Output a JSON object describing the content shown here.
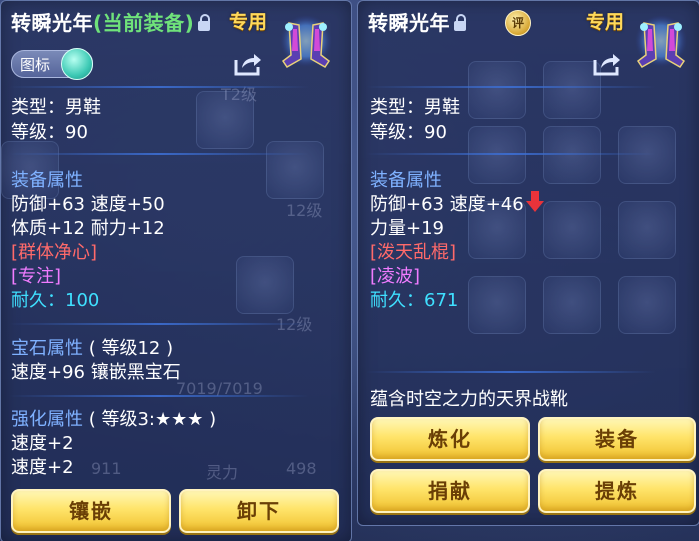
{
  "left_panel": {
    "title": "转瞬光年",
    "title_status": "(当前装备)",
    "exclusive_tag": "专用",
    "toggle_label": "图标",
    "type_line": "类型：男鞋",
    "level_line": "等级：90",
    "equip_attr_header": "装备属性",
    "attr_line1": "防御+63 速度+50",
    "attr_line2": "体质+12 耐力+12",
    "special_skill": "[群体净心]",
    "special_effect": "[专注]",
    "durability": "耐久：100",
    "gem_header": "宝石属性",
    "gem_level": "( 等级12 )",
    "gem_line": "速度+96 镶嵌黑宝石",
    "enhance_header": "强化属性",
    "enhance_level": "( 等级3:★★★ )",
    "enhance_line1": "速度+2",
    "enhance_line2": "速度+2",
    "buttons": {
      "inlay": "镶嵌",
      "unequip": "卸下"
    },
    "ghost_texts": [
      "T2级",
      "12级",
      "12级",
      "911",
      "灵力",
      "498",
      "7019/7019"
    ]
  },
  "right_panel": {
    "title": "转瞬光年",
    "rate_badge": "评",
    "exclusive_tag": "专用",
    "type_line": "类型：男鞋",
    "level_line": "等级：90",
    "equip_attr_header": "装备属性",
    "attr_line1": "防御+63 速度+46",
    "attr_line2": "力量+19",
    "special_skill": "[泼天乱棍]",
    "special_effect": "[凌波]",
    "durability": "耐久：671",
    "description": "蕴含时空之力的天界战靴",
    "buttons": {
      "refine": "炼化",
      "equip": "装备",
      "donate": "捐献",
      "extract": "提炼"
    }
  },
  "colors": {
    "panel_bg": "#2c3a6a",
    "header_blue": "#7fb1ff",
    "special_red": "#ff6a6a",
    "special_pink": "#f07cff",
    "durability_cyan": "#3fe0ff",
    "equipped_green": "#6fe27a",
    "exclusive_gold": "#ffd95a",
    "button_gold": "#f0c12f",
    "button_text": "#6a3f06",
    "arrow_red": "#e8333a"
  }
}
